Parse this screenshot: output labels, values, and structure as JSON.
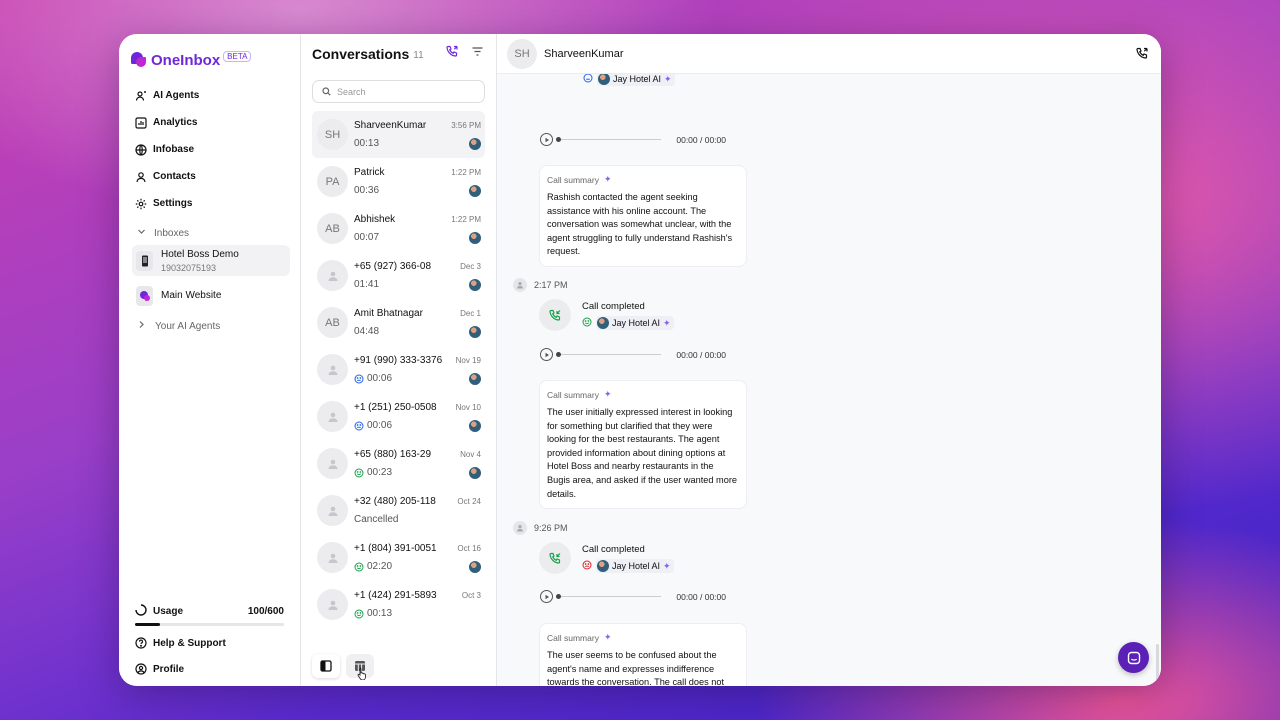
{
  "brand": {
    "name": "OneInbox",
    "badge": "BETA"
  },
  "nav": {
    "items": [
      {
        "label": "AI Agents"
      },
      {
        "label": "Analytics"
      },
      {
        "label": "Infobase"
      },
      {
        "label": "Contacts"
      },
      {
        "label": "Settings"
      }
    ],
    "inboxes_label": "Inboxes",
    "inboxes": [
      {
        "title": "Hotel Boss Demo",
        "subtitle": "19032075193"
      },
      {
        "title": "Main Website",
        "subtitle": ""
      }
    ],
    "your_agents_label": "Your AI Agents"
  },
  "usage": {
    "label": "Usage",
    "value": "100/600",
    "fraction": 0.1667
  },
  "bottom_nav": {
    "help": "Help & Support",
    "profile": "Profile"
  },
  "conversations": {
    "title": "Conversations",
    "count": "11",
    "search_placeholder": "Search",
    "items": [
      {
        "initials": "SH",
        "name": "SharveenKumar",
        "time": "3:56 PM",
        "meta": "00:13",
        "sentiment": "",
        "agent": true
      },
      {
        "initials": "PA",
        "name": "Patrick",
        "time": "1:22 PM",
        "meta": "00:36",
        "sentiment": "",
        "agent": true
      },
      {
        "initials": "AB",
        "name": "Abhishek",
        "time": "1:22 PM",
        "meta": "00:07",
        "sentiment": "",
        "agent": true
      },
      {
        "initials": "",
        "name": "+65 (927) 366-08",
        "time": "Dec 3",
        "meta": "01:41",
        "sentiment": "",
        "agent": true
      },
      {
        "initials": "AB",
        "name": "Amit Bhatnagar",
        "time": "Dec 1",
        "meta": "04:48",
        "sentiment": "",
        "agent": true
      },
      {
        "initials": "",
        "name": "+91 (990) 333-3376",
        "time": "Nov 19",
        "meta": "00:06",
        "sentiment": "neutral",
        "agent": true
      },
      {
        "initials": "",
        "name": "+1 (251) 250-0508",
        "time": "Nov 10",
        "meta": "00:06",
        "sentiment": "neutral",
        "agent": true
      },
      {
        "initials": "",
        "name": "+65 (880) 163-29",
        "time": "Nov 4",
        "meta": "00:23",
        "sentiment": "positive",
        "agent": true
      },
      {
        "initials": "",
        "name": "+32 (480) 205-118",
        "time": "Oct 24",
        "meta": "Cancelled",
        "sentiment": "",
        "agent": false
      },
      {
        "initials": "",
        "name": "+1 (804) 391-0051",
        "time": "Oct 16",
        "meta": "02:20",
        "sentiment": "positive",
        "agent": true
      },
      {
        "initials": "",
        "name": "+1 (424) 291-5893",
        "time": "Oct 3",
        "meta": "00:13",
        "sentiment": "positive",
        "agent": false
      }
    ]
  },
  "chat": {
    "contact_initials": "SH",
    "contact_name": "SharveenKumar",
    "top_partial_agent": "Jay Hotel AI",
    "blocks": [
      {
        "time": "",
        "status": "",
        "agent": "",
        "player_time": "00:00 / 00:00",
        "summary_label": "Call summary",
        "summary": "Rashish contacted the agent seeking assistance with his online account. The conversation was somewhat unclear, with the agent struggling to fully understand Rashish's request."
      },
      {
        "time": "2:17 PM",
        "status": "Call completed",
        "agent": "Jay Hotel AI",
        "player_time": "00:00 / 00:00",
        "summary_label": "Call summary",
        "summary": "The user initially expressed interest in looking for something but clarified that they were looking for the best restaurants. The agent provided information about dining options at Hotel Boss and nearby restaurants in the Bugis area, and asked if the user wanted more details."
      },
      {
        "time": "9:26 PM",
        "status": "Call completed",
        "agent": "Jay Hotel AI",
        "player_time": "00:00 / 00:00",
        "summary_label": "Call summary",
        "summary": "The user seems to be confused about the agent's name and expresses indifference towards the conversation. The call does not progress beyond the initial greeting."
      }
    ]
  },
  "colors": {
    "brand": "#6d28d9",
    "positive": "#16a34a",
    "negative": "#dc2626",
    "neutral": "#2563eb"
  }
}
